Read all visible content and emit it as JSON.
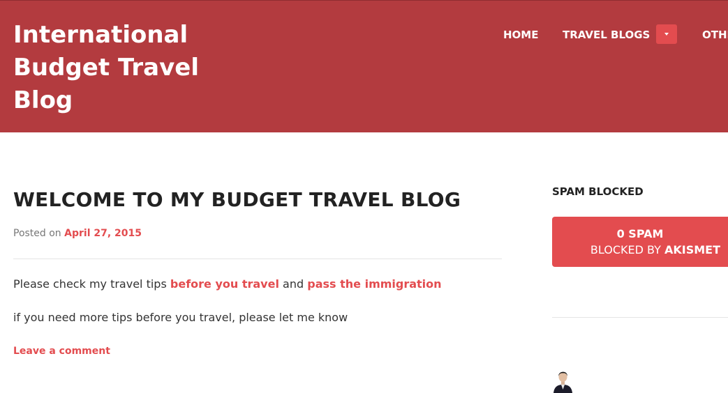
{
  "header": {
    "site_title": "International Budget Travel Blog",
    "nav": {
      "home": "HOME",
      "travel_blogs": "TRAVEL BLOGS",
      "other": "OTHER"
    }
  },
  "post": {
    "title": "WELCOME TO MY BUDGET TRAVEL BLOG",
    "meta_prefix": "Posted on",
    "date": "April 27, 2015",
    "para1_text": "Please check my travel tips",
    "para1_link1": "before you travel",
    "para1_and": "and",
    "para1_link2": "pass the immigration",
    "para2": "if you need more tips before you travel, please let me know",
    "leave_comment": "Leave a comment"
  },
  "sidebar": {
    "widget_title": "SPAM BLOCKED",
    "spam_count": "0 SPAM",
    "blocked_by": "BLOCKED BY",
    "akismet": "AKISMET"
  },
  "colors": {
    "header_bg": "#b33b3f",
    "accent": "#e34c4f",
    "title_text": "#222222"
  }
}
